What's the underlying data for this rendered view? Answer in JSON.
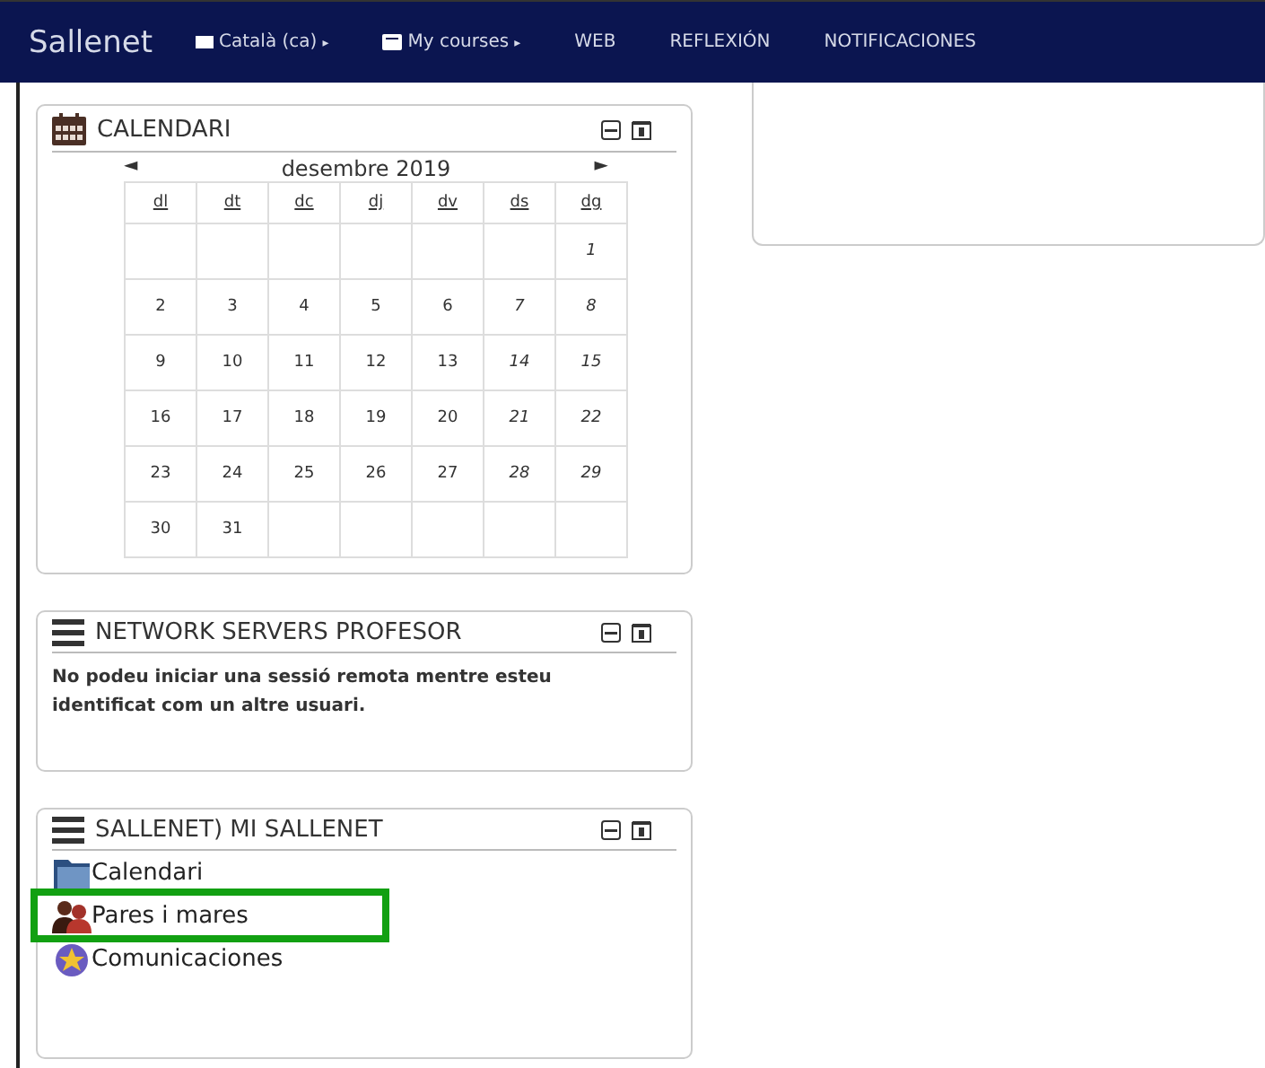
{
  "navbar": {
    "brand": "Sallenet",
    "items": [
      {
        "kind": "menu",
        "label": "Català (ca)",
        "caret": "▸"
      },
      {
        "kind": "menu",
        "label": "My courses",
        "caret": "▸"
      },
      {
        "kind": "link",
        "label": "WEB"
      },
      {
        "kind": "link",
        "label": "REFLEXIÓN"
      },
      {
        "kind": "link",
        "label": "NOTIFICACIONES"
      }
    ]
  },
  "calendar_block": {
    "title": "CALENDARI",
    "prev": "◄",
    "next": "►",
    "month": "desembre 2019",
    "weekdays": [
      "dl",
      "dt",
      "dc",
      "dj",
      "dv",
      "ds",
      "dg"
    ],
    "weeks": [
      [
        "1"
      ],
      [
        "2",
        "3",
        "4",
        "5",
        "6",
        "7",
        "8"
      ],
      [
        "9",
        "10",
        "11",
        "12",
        "13",
        "14",
        "15"
      ],
      [
        "16",
        "17",
        "18",
        "19",
        "20",
        "21",
        "22"
      ],
      [
        "23",
        "24",
        "25",
        "26",
        "27",
        "28",
        "29"
      ],
      [
        "30",
        "31"
      ]
    ]
  },
  "network_block": {
    "title": "NETWORK SERVERS PROFESOR",
    "text": "No podeu iniciar una sessió remota mentre esteu identificat com un altre usuari."
  },
  "sallenet_block": {
    "title": "SALLENET) MI SALLENET",
    "items": [
      {
        "label": "Calendari",
        "highlighted": false
      },
      {
        "label": "Pares i mares",
        "highlighted": true
      },
      {
        "label": "Comunicaciones",
        "highlighted": false
      }
    ]
  }
}
